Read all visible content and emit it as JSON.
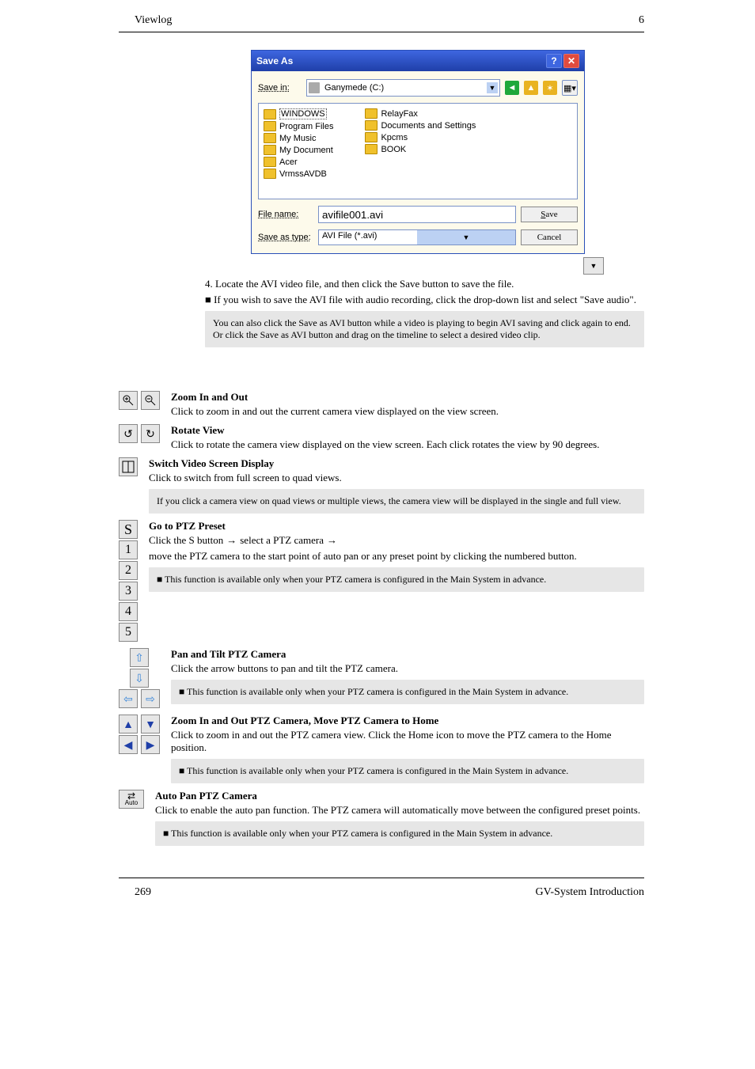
{
  "header": {
    "left": "Viewlog",
    "right": "6"
  },
  "footer": {
    "left": "269",
    "right": "GV-System Introduction"
  },
  "dialog": {
    "title": "Save As",
    "save_in_label": "Save in:",
    "save_in_value": "Ganymede (C:)",
    "files_col1": [
      "WINDOWS",
      "Program Files",
      "My Music",
      "My Document",
      "Acer",
      "VrmssAVDB"
    ],
    "files_col2": [
      "RelayFax",
      "Documents and Settings",
      "Kpcms",
      "BOOK"
    ],
    "file_name_label": "File name:",
    "file_name_value": "avifile001.avi",
    "save_type_label": "Save as type:",
    "save_type_value": "AVI File (*.avi)",
    "save_btn": "Save",
    "cancel_btn": "Cancel"
  },
  "intro": {
    "p1": "4. Locate the AVI video file, and then click the Save button to save the file.",
    "dropdown_text": "■ If you wish to save the AVI file with audio recording, click the drop-down list and select \"Save audio\".",
    "gray_block": "You can also click the Save as AVI button while a video is playing to begin AVI saving and click again to end. Or click the Save as AVI button and drag on the timeline to select a desired video clip."
  },
  "rows": [
    {
      "name": "zoom",
      "title": "Zoom In and Out",
      "body": "Click to zoom in and out the current camera view displayed on the view screen."
    },
    {
      "name": "rotate",
      "title": "Rotate View",
      "body": "Click to rotate the camera view displayed on the view screen. Each click rotates the view by 90 degrees."
    },
    {
      "name": "split",
      "title": "Switch Video Screen Display",
      "body": "Click to switch from full screen to quad views.",
      "gray": "If you click a camera view on quad views or multiple views, the camera view will be displayed in the single and full view."
    },
    {
      "name": "ptz",
      "title": "Go to PTZ Preset",
      "line": "Click the S button → select a PTZ camera → move the PTZ camera to the start point of auto pan or any preset point by clicking the numbered button.",
      "gray": "■ This function is available only when your PTZ camera is configured in the Main System in advance."
    },
    {
      "name": "pantilt",
      "title": "Pan and Tilt PTZ Camera",
      "body": "Click the arrow buttons to pan and tilt the PTZ camera.",
      "gray": "■ This function is available only when your PTZ camera is configured in the Main System in advance."
    },
    {
      "name": "ptzzoom",
      "title": "Zoom In and Out PTZ Camera, Move PTZ Camera to Home",
      "body": "Click to zoom in and out the PTZ camera view. Click the Home icon to move the PTZ camera to the Home position.",
      "gray": "■ This function is available only when your PTZ camera is configured in the Main System in advance."
    },
    {
      "name": "autopan",
      "title": "Auto Pan PTZ Camera",
      "body": "Click to enable the auto pan function. The PTZ camera will automatically move between the configured preset points.",
      "gray": "■ This function is available only when your PTZ camera is configured in the Main System in advance."
    }
  ]
}
